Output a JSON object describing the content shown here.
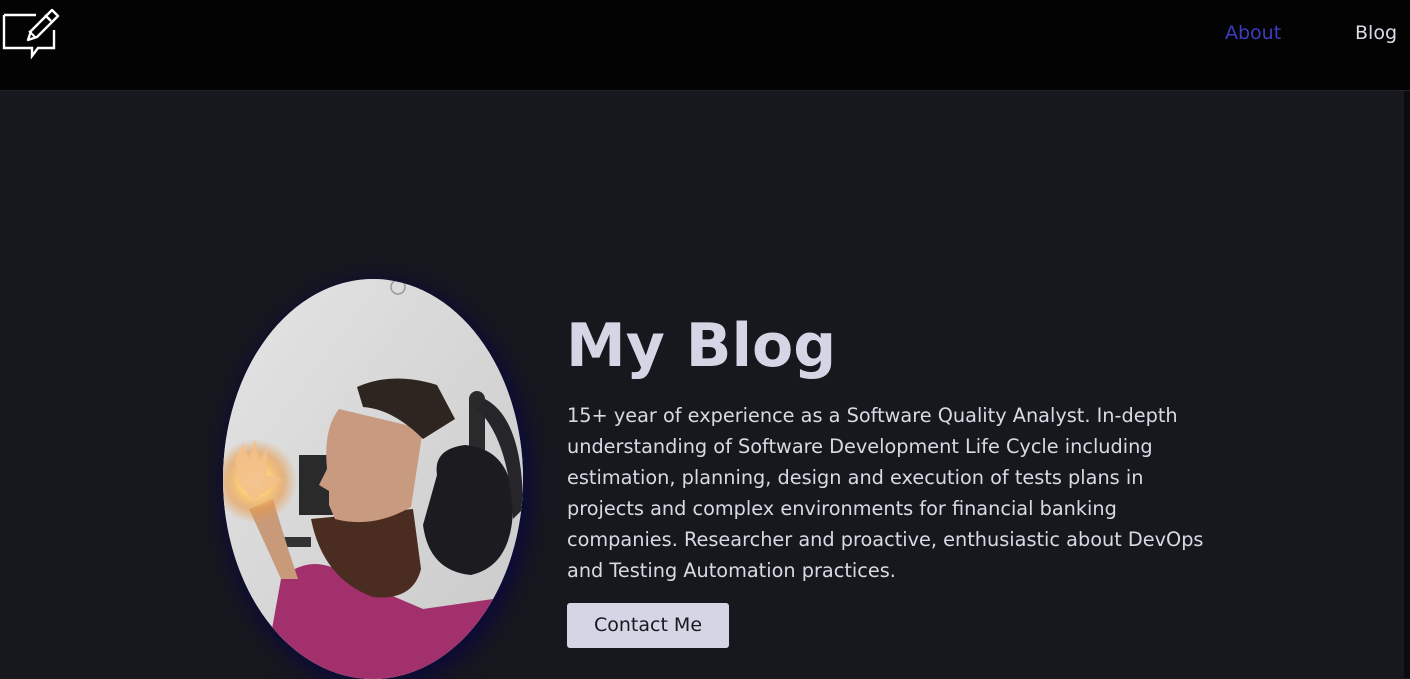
{
  "nav": {
    "logo_icon": "pencil-speech-bubble-icon",
    "links": [
      {
        "label": "About",
        "active": true
      },
      {
        "label": "Blog",
        "active": false
      }
    ]
  },
  "hero": {
    "title": "My Blog",
    "description": "15+ year of experience as a Software Quality Analyst. In-depth understanding of Software Development Life Cycle including estimation, planning, design and execution of tests plans in projects and complex environments for financial banking companies. Researcher and proactive, enthusiastic about DevOps and Testing Automation practices.",
    "contact_label": "Contact Me",
    "avatar_icon": "profile-photo"
  },
  "colors": {
    "background": "#17181e",
    "header": "#030304",
    "accent_active": "#3c3dbf",
    "title": "#d6d5e6",
    "button_bg": "#d6d5e6"
  }
}
